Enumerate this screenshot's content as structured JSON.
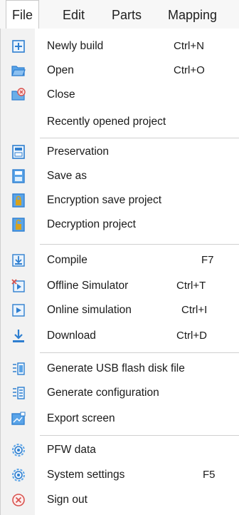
{
  "menubar": {
    "items": [
      {
        "label": "File"
      },
      {
        "label": "Edit"
      },
      {
        "label": "Parts"
      },
      {
        "label": "Mapping"
      }
    ]
  },
  "file_menu": {
    "items": [
      {
        "label": "Newly build",
        "shortcut": "Ctrl+N",
        "icon": "new-file-icon"
      },
      {
        "label": "Open",
        "shortcut": "Ctrl+O",
        "icon": "open-folder-icon"
      },
      {
        "label": "Close",
        "shortcut": "",
        "icon": "close-project-icon"
      },
      {
        "label": "Recently opened project",
        "shortcut": "",
        "icon": ""
      },
      {
        "label": "Preservation",
        "shortcut": "",
        "icon": "save-icon"
      },
      {
        "label": "Save as",
        "shortcut": "",
        "icon": "save-as-icon"
      },
      {
        "label": "Encryption save project",
        "shortcut": "",
        "icon": "lock-save-icon"
      },
      {
        "label": "Decryption project",
        "shortcut": "",
        "icon": "unlock-icon"
      },
      {
        "label": "Compile",
        "shortcut": "F7",
        "icon": "compile-icon"
      },
      {
        "label": "Offline Simulator",
        "shortcut": "Ctrl+T",
        "icon": "offline-simulator-icon"
      },
      {
        "label": "Online simulation",
        "shortcut": "Ctrl+I",
        "icon": "online-simulation-icon"
      },
      {
        "label": "Download",
        "shortcut": "Ctrl+D",
        "icon": "download-icon"
      },
      {
        "label": "Generate USB flash disk file",
        "shortcut": "",
        "icon": "usb-file-icon"
      },
      {
        "label": "Generate configuration",
        "shortcut": "",
        "icon": "configuration-icon"
      },
      {
        "label": "Export screen",
        "shortcut": "",
        "icon": "export-screen-icon"
      },
      {
        "label": "PFW data",
        "shortcut": "",
        "icon": "gear-icon"
      },
      {
        "label": "System settings",
        "shortcut": "F5",
        "icon": "settings-gear-icon"
      },
      {
        "label": "Sign out",
        "shortcut": "",
        "icon": "sign-out-icon"
      }
    ]
  },
  "colors": {
    "icon_blue": "#2f7fd0",
    "icon_light_blue": "#5aa4e8",
    "icon_gold": "#d8a21c",
    "icon_red": "#d9534f",
    "separator": "#d0d0d0"
  }
}
